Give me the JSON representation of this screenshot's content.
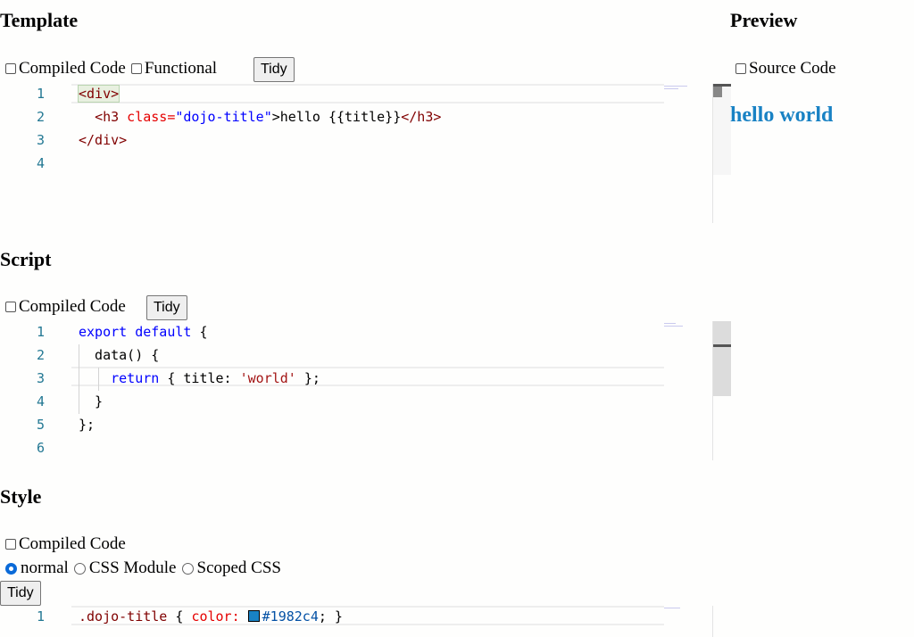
{
  "template": {
    "heading": "Template",
    "compiled_label": "Compiled Code",
    "functional_label": "Functional",
    "tidy_label": "Tidy",
    "line_numbers": [
      "1",
      "2",
      "3",
      "4"
    ],
    "lines": {
      "l1_open": "<div>",
      "l2_indent": "  ",
      "l2_tag": "<h3",
      "l2_attr": " class=",
      "l2_str": "\"dojo-title\"",
      "l2_text": ">hello {{title}}",
      "l2_close": "</h3>",
      "l3": "</div>"
    }
  },
  "preview": {
    "heading": "Preview",
    "source_label": "Source Code",
    "rendered_title": "hello world",
    "title_color": "#1982c4"
  },
  "script": {
    "heading": "Script",
    "compiled_label": "Compiled Code",
    "tidy_label": "Tidy",
    "line_numbers": [
      "1",
      "2",
      "3",
      "4",
      "5",
      "6"
    ],
    "lines": {
      "l1_kw": "export default",
      "l1_rest": " {",
      "l2": "  data() {",
      "l3_indent": "    ",
      "l3_kw": "return",
      "l3_a": " { title: ",
      "l3_str": "'world'",
      "l3_b": " };",
      "l4": "  }",
      "l5": "};"
    }
  },
  "style": {
    "heading": "Style",
    "compiled_label": "Compiled Code",
    "radio_normal": "normal",
    "radio_module": "CSS Module",
    "radio_scoped": "Scoped CSS",
    "selected_mode": "normal",
    "tidy_label": "Tidy",
    "line_numbers": [
      "1"
    ],
    "lines": {
      "l1_sel": ".dojo-title",
      "l1_a": " { ",
      "l1_prop": "color:",
      "l1_hex": "#1982c4",
      "l1_b": "; }"
    }
  }
}
